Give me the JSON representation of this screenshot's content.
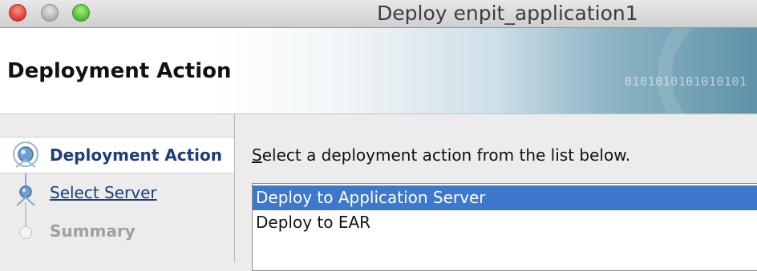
{
  "window": {
    "title": "Deploy enpit_application1"
  },
  "header": {
    "title": "Deployment Action",
    "decor_text": "0101010101010101"
  },
  "steps": [
    {
      "label": "Deployment Action",
      "state": "current"
    },
    {
      "label": "Select Server",
      "state": "link"
    },
    {
      "label": "Summary",
      "state": "disabled"
    }
  ],
  "content": {
    "instruction_mnemonic": "S",
    "instruction_rest": "elect a deployment action from the list below.",
    "options": [
      {
        "label": "Deploy to Application Server",
        "selected": true
      },
      {
        "label": "Deploy to EAR",
        "selected": false
      }
    ]
  },
  "colors": {
    "selection": "#3d78cc",
    "link": "#1e3d7a"
  }
}
